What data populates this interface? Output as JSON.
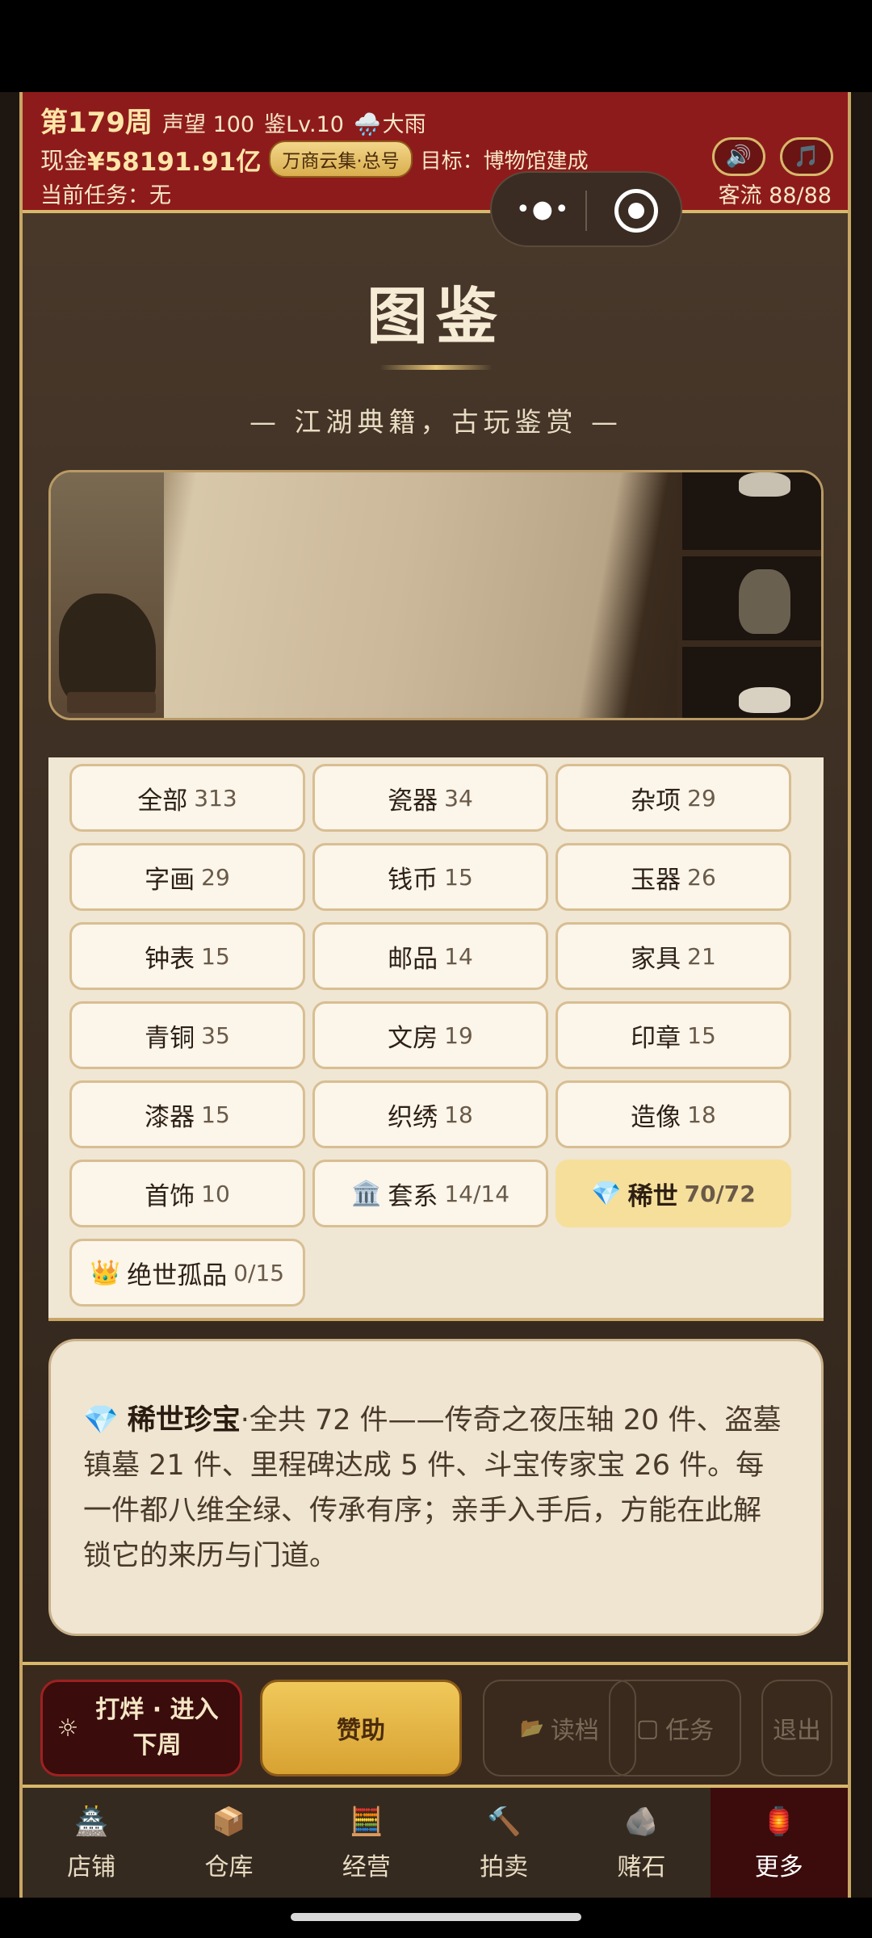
{
  "header": {
    "week": "第179周",
    "reputation": "声望 100",
    "appraisal_level": "鉴Lv.10",
    "weather_icon": "🌧️",
    "weather": "大雨",
    "cash_label": "现金",
    "cash_value": "¥58191.91亿",
    "shop_badge": "万商云集·总号",
    "goal": "目标：博物馆建成",
    "task": "当前任务：无",
    "sound_icon": "🔊",
    "music_icon": "🎵",
    "visitors": "客流 88/88"
  },
  "capsule": {
    "more_icon": "•●•",
    "close_icon": "target-icon"
  },
  "page": {
    "title": "图鉴",
    "subtitle": "— 江湖典籍，古玩鉴赏 —"
  },
  "categories": [
    {
      "label": "全部",
      "count": "313"
    },
    {
      "label": "瓷器",
      "count": "34"
    },
    {
      "label": "杂项",
      "count": "29"
    },
    {
      "label": "字画",
      "count": "29"
    },
    {
      "label": "钱币",
      "count": "15"
    },
    {
      "label": "玉器",
      "count": "26"
    },
    {
      "label": "钟表",
      "count": "15"
    },
    {
      "label": "邮品",
      "count": "14"
    },
    {
      "label": "家具",
      "count": "21"
    },
    {
      "label": "青铜",
      "count": "35"
    },
    {
      "label": "文房",
      "count": "19"
    },
    {
      "label": "印章",
      "count": "15"
    },
    {
      "label": "漆器",
      "count": "15"
    },
    {
      "label": "织绣",
      "count": "18"
    },
    {
      "label": "造像",
      "count": "18"
    },
    {
      "label": "首饰",
      "count": "10"
    },
    {
      "label": "套系",
      "count": "14/14",
      "icon": "🏛️"
    },
    {
      "label": "稀世",
      "count": "70/72",
      "icon": "💎",
      "active": true
    },
    {
      "label": "绝世孤品",
      "count": "0/15",
      "icon": "👑"
    }
  ],
  "info": {
    "icon": "💎",
    "heading": "稀世珍宝",
    "text": "·全共 72 件——传奇之夜压轴 20 件、盗墓镇墓 21 件、里程碑达成 5 件、斗宝传家宝 26 件。每一件都八维全绿、传承有序；亲手入手后，方能在此解锁它的来历与门道。"
  },
  "actions": {
    "close_icon": "☼",
    "close_label": "打烊 · 进入下周",
    "sponsor_label": "赞助",
    "load_icon": "📂",
    "load_label": "读档",
    "task_icon": "▢",
    "task_label": "任务",
    "exit_label": "退出"
  },
  "tabs": [
    {
      "label": "店铺",
      "icon": "🏯"
    },
    {
      "label": "仓库",
      "icon": "📦"
    },
    {
      "label": "经营",
      "icon": "🧮"
    },
    {
      "label": "拍卖",
      "icon": "🔨"
    },
    {
      "label": "赌石",
      "icon": "🪨"
    },
    {
      "label": "更多",
      "icon": "🏮",
      "active": true
    }
  ]
}
